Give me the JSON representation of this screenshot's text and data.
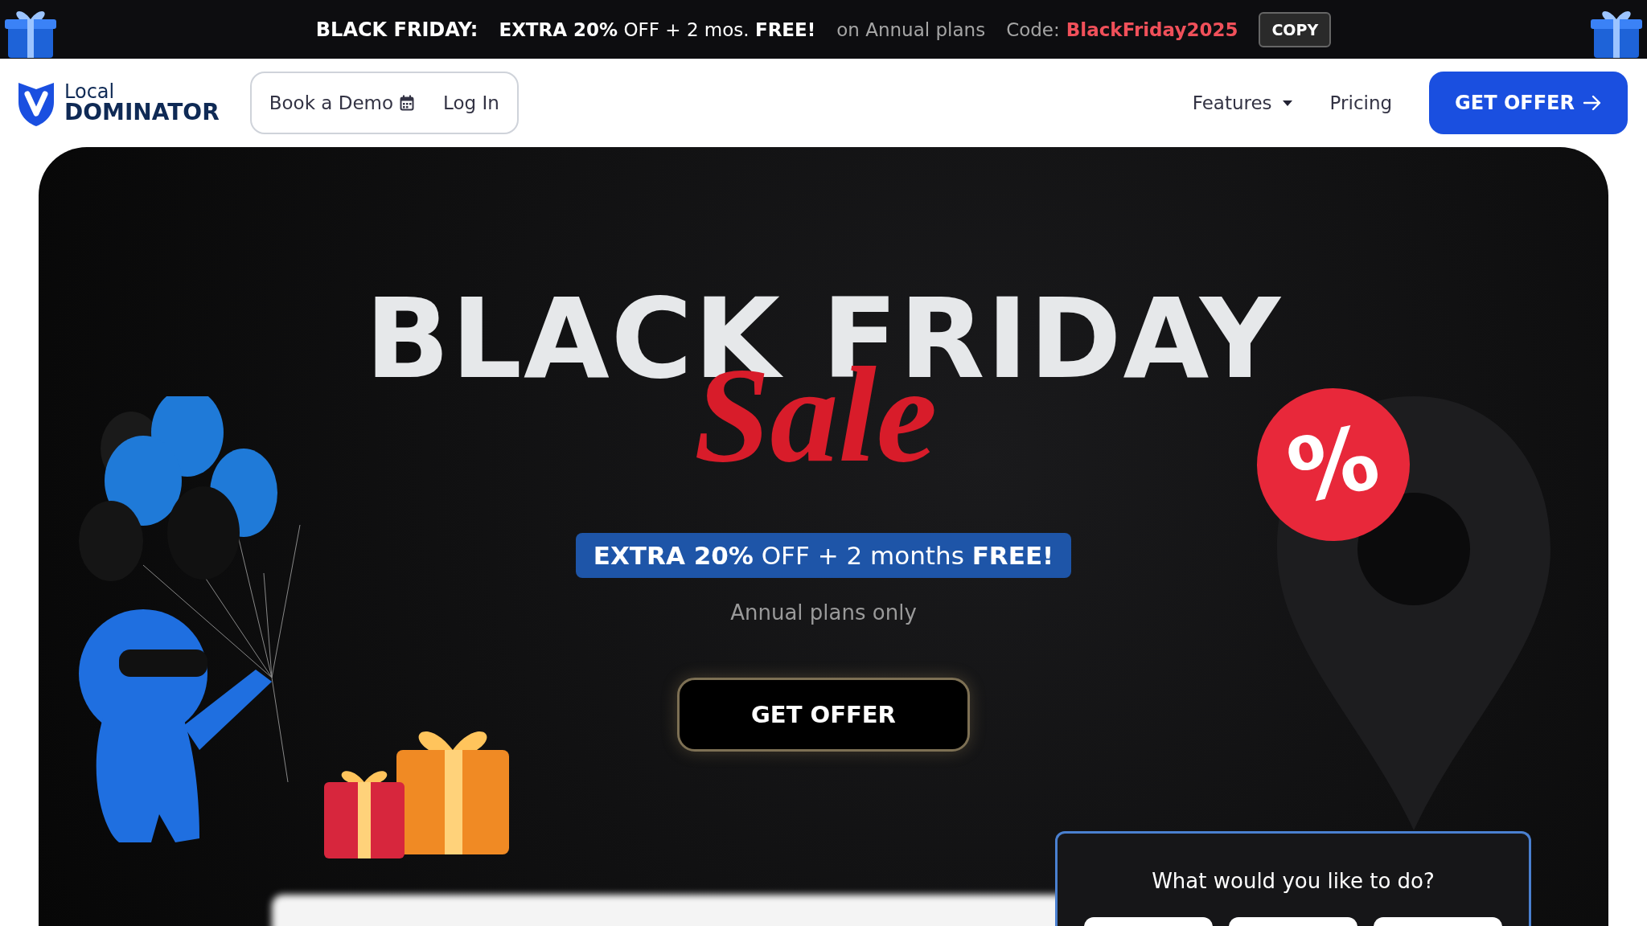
{
  "promo_bar": {
    "label": "BLACK FRIDAY:",
    "offer": "**EXTRA 20%** OFF + 2 mos. **FREE!**",
    "condition": "on Annual plans",
    "code_label": "Code:",
    "code": "BlackFriday2025",
    "copy_button": "COPY"
  },
  "nav": {
    "logo": {
      "top": "Local",
      "bottom": "DOMINATOR"
    },
    "demo": "Book a Demo",
    "login": "Log In",
    "links": [
      {
        "label": "Features",
        "dropdown": true
      },
      {
        "label": "Pricing",
        "dropdown": false
      }
    ],
    "cta": "GET OFFER"
  },
  "hero": {
    "title": "BLACK FRIDAY",
    "script": "Sale",
    "badge": "**EXTRA 20%** OFF + 2 months **FREE!**",
    "note": "Annual plans only",
    "button": "GET OFFER",
    "percent": "%"
  },
  "panel": {
    "title": "What would you like to do?"
  }
}
